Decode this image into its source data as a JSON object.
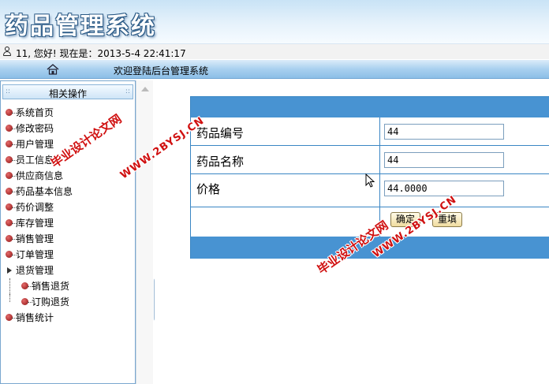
{
  "header": {
    "title": "药品管理系统"
  },
  "infobar": {
    "greeting": "11, 您好! 现在是：2013-5-4 22:41:17"
  },
  "navbar": {
    "welcome": "欢迎登陆后台管理系统"
  },
  "sidebar": {
    "title": "相关操作",
    "items": [
      {
        "label": "系统首页"
      },
      {
        "label": "修改密码"
      },
      {
        "label": "用户管理"
      },
      {
        "label": "员工信息"
      },
      {
        "label": "供应商信息"
      },
      {
        "label": "药品基本信息"
      },
      {
        "label": "药价调整"
      },
      {
        "label": "库存管理"
      },
      {
        "label": "销售管理"
      },
      {
        "label": "订单管理"
      },
      {
        "label": "退货管理",
        "children": [
          {
            "label": "销售退货"
          },
          {
            "label": "订购退货"
          }
        ]
      },
      {
        "label": "销售统计"
      }
    ]
  },
  "form": {
    "fields": [
      {
        "label": "药品编号",
        "value": "44"
      },
      {
        "label": "药品名称",
        "value": "44"
      },
      {
        "label": "价格",
        "value": "44.0000"
      }
    ],
    "submit_label": "确定",
    "reset_label": "重填"
  },
  "watermarks": {
    "line1": "毕业设计论文网",
    "line2": "WWW.2BYSJ.CN"
  },
  "icons": {
    "user": "user-icon",
    "home": "home-icon",
    "menu_bullet": "bullet-icon",
    "collapse": "collapse-arrow-icon"
  },
  "colors": {
    "form_border": "#3a86c4",
    "form_bar": "#4893d2",
    "nav_bar": "#a9d0ef",
    "watermark": "#d01010"
  }
}
